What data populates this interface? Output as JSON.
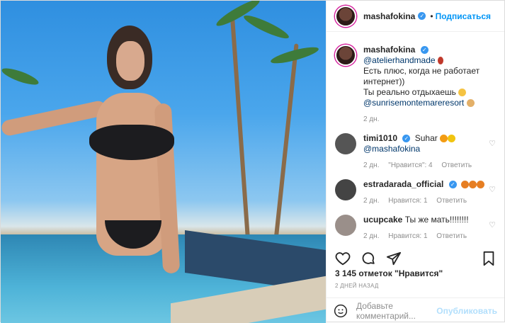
{
  "post": {
    "username": "mashafokina",
    "follow_label": "Подписаться",
    "caption": {
      "mention": "@atelierhandmade",
      "line1": "Есть плюс, когда не работает интернет))",
      "line2": "Ты реально отдыхаешь",
      "resort": "@sunrisemontemareresort",
      "age": "2 дн."
    },
    "comments": [
      {
        "user": "timi1010",
        "text": "Suhar",
        "mention": "@mashafokina",
        "age": "2 дн.",
        "likes": "\"Нравится\": 4",
        "reply": "Ответить",
        "avatar_color": "#555"
      },
      {
        "user": "estradarada_official",
        "text": "",
        "age": "2 дн.",
        "likes": "Нравится: 1",
        "reply": "Ответить",
        "avatar_color": "#444"
      },
      {
        "user": "ucupcake",
        "text": "Ты же мать!!!!!!!!",
        "age": "2 дн.",
        "likes": "Нравится: 1",
        "reply": "Ответить",
        "avatar_color": "#9a8f8a"
      }
    ],
    "likes_count": "3 145 отметок \"Нравится\"",
    "date": "2 ДНЕЙ НАЗАД",
    "comment_placeholder": "Добавьте комментарий...",
    "publish_label": "Опубликовать"
  },
  "icons": [
    "heart-icon",
    "comment-icon",
    "share-icon",
    "bookmark-icon",
    "emoji-icon",
    "verified-icon"
  ],
  "colors": {
    "accent": "#0095f6",
    "verified": "#3897f0"
  }
}
